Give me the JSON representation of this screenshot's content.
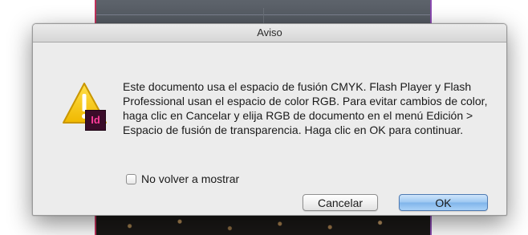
{
  "dialog": {
    "title": "Aviso",
    "app_icon": "indesign-warning-icon",
    "app_badge": "Id",
    "message": "Este documento usa el espacio de fusión CMYK. Flash Player y Flash Professional usan el espacio de color RGB. Para evitar cambios de color, haga clic en Cancelar y elija RGB de documento en el menú Edición > Espacio de fusión de transparencia. Haga clic en OK para continuar.",
    "checkbox": {
      "label": "No volver a mostrar",
      "checked": false
    },
    "buttons": {
      "cancel_label": "Cancelar",
      "ok_label": "OK"
    }
  },
  "colors": {
    "warning_yellow": "#f5c400",
    "id_badge_bg": "#3b0c2a",
    "id_badge_text": "#ff3d9a",
    "default_button": "#9cc7f1"
  }
}
